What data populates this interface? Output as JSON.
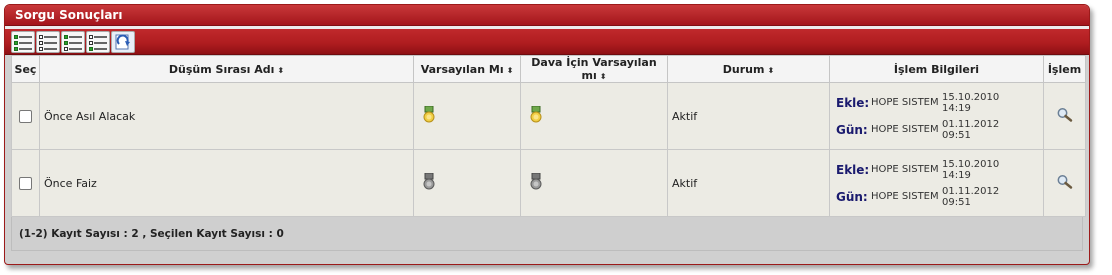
{
  "panel": {
    "title": "Sorgu Sonuçları"
  },
  "toolbar": {
    "buttons": [
      {
        "name": "select-all-icon"
      },
      {
        "name": "deselect-all-icon"
      },
      {
        "name": "select-page-icon"
      },
      {
        "name": "deselect-page-icon"
      },
      {
        "name": "refresh-icon"
      }
    ]
  },
  "table": {
    "headers": {
      "sec": "Seç",
      "name": "Düşüm Sırası Adı",
      "default": "Varsayılan Mı",
      "case_default": "Dava İçin Varsayılan mı",
      "status": "Durum",
      "info": "İşlem Bilgileri",
      "action": "İşlem"
    },
    "sort_glyph": "⬍",
    "rows": [
      {
        "name": "Önce Asıl Alacak",
        "default": "gold-medal-icon",
        "case_default": "gold-medal-icon",
        "status": "Aktif",
        "add_label": "Ekle:",
        "add_user": "HOPE SISTEM",
        "add_date": "15.10.2010",
        "add_time": "14:19",
        "upd_label": "Gün:",
        "upd_user": "HOPE SISTEM",
        "upd_date": "01.11.2012",
        "upd_time": "09:51"
      },
      {
        "name": "Önce Faiz",
        "default": "gray-medal-icon",
        "case_default": "gray-medal-icon",
        "status": "Aktif",
        "add_label": "Ekle:",
        "add_user": "HOPE SISTEM",
        "add_date": "15.10.2010",
        "add_time": "14:19",
        "upd_label": "Gün:",
        "upd_user": "HOPE SISTEM",
        "upd_date": "01.11.2012",
        "upd_time": "09:51"
      }
    ]
  },
  "footer": {
    "summary": "(1-2) Kayıt Sayısı : 2   , Seçilen Kayıt Sayısı : 0"
  },
  "colors": {
    "accent": "#b01d20",
    "gold": "#e8c23a",
    "gray": "#8a8a8a"
  }
}
